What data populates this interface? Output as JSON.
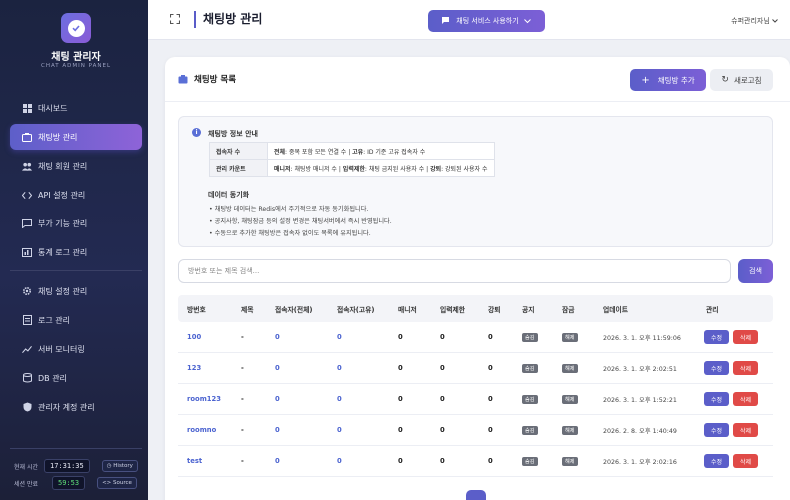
{
  "sidebar": {
    "brand_title": "채팅 관리자",
    "brand_sub": "CHAT ADMIN PANEL",
    "items": [
      {
        "label": "대시보드",
        "icon": "dashboard-icon"
      },
      {
        "label": "채팅방 관리",
        "icon": "chatroom-icon",
        "active": true
      },
      {
        "label": "채팅 회원 관리",
        "icon": "users-icon"
      },
      {
        "label": "API 설정 관리",
        "icon": "code-icon"
      },
      {
        "label": "부가 기능 관리",
        "icon": "message-icon"
      },
      {
        "label": "통계 로그 관리",
        "icon": "chart-icon"
      },
      {
        "label": "채팅 설정 관리",
        "icon": "gear-icon"
      },
      {
        "label": "로그 관리",
        "icon": "document-icon"
      },
      {
        "label": "서버 모니터링",
        "icon": "monitor-icon"
      },
      {
        "label": "DB 관리",
        "icon": "database-icon"
      },
      {
        "label": "관리자 계정 관리",
        "icon": "shield-icon"
      }
    ],
    "current_time_label": "현재 시간",
    "current_time": "17:31:35",
    "history_label": "History",
    "session_label": "세션 만료",
    "session_time": "59:53",
    "source_label": "Source"
  },
  "topbar": {
    "title": "채팅방 관리",
    "service_button": "채팅 서비스 사용하기",
    "user": "슈퍼관리자님"
  },
  "card": {
    "title": "채팅방 목록",
    "add_button": "채팅방 추가",
    "refresh_button": "새로고침"
  },
  "info": {
    "title": "채팅방 정보 안내",
    "rows": [
      {
        "key": "접속자 수",
        "value_parts": [
          {
            "b": "전체"
          },
          {
            "t": ": 중복 포함 모든 연결 수  |  "
          },
          {
            "b": "고유"
          },
          {
            "t": ": ID 기준 고유 접속자 수"
          }
        ]
      },
      {
        "key": "관리 카운트",
        "value_parts": [
          {
            "b": "매니저"
          },
          {
            "t": ": 채팅방 매니저 수  |  "
          },
          {
            "b": "입력제한"
          },
          {
            "t": ": 채팅 금지된 사용자 수  |  "
          },
          {
            "b": "강퇴"
          },
          {
            "t": ": 강퇴된 사용자 수"
          }
        ]
      }
    ],
    "sync_title": "데이터 동기화",
    "sync_items": [
      "채팅방 데이터는 Redis에서 주기적으로 자동 동기화됩니다.",
      "공지사항, 채팅잠금 등의 설정 변경은 채팅서버에서 즉시 반영됩니다.",
      "수동으로 추가한 채팅방은 접속자 없이도 목록에 유지됩니다."
    ]
  },
  "search": {
    "placeholder": "방번호 또는 제목 검색...",
    "button": "검색"
  },
  "table": {
    "headers": [
      "방번호",
      "제목",
      "접속자(전체)",
      "접속자(고유)",
      "매니저",
      "입력제한",
      "강퇴",
      "공지",
      "잠금",
      "업데이트",
      "관리"
    ],
    "rows": [
      {
        "id": "100",
        "title": "-",
        "total": "0",
        "unique": "0",
        "managers": "0",
        "restricted": "0",
        "kicked": "0",
        "notice": "숨김",
        "lock": "해제",
        "updated": "2026. 3. 1. 오후 11:59:06"
      },
      {
        "id": "123",
        "title": "-",
        "total": "0",
        "unique": "0",
        "managers": "0",
        "restricted": "0",
        "kicked": "0",
        "notice": "숨김",
        "lock": "해제",
        "updated": "2026. 3. 1. 오후 2:02:51"
      },
      {
        "id": "room123",
        "title": "-",
        "total": "0",
        "unique": "0",
        "managers": "0",
        "restricted": "0",
        "kicked": "0",
        "notice": "숨김",
        "lock": "해제",
        "updated": "2026. 3. 1. 오후 1:52:21"
      },
      {
        "id": "roomno",
        "title": "-",
        "total": "0",
        "unique": "0",
        "managers": "0",
        "restricted": "0",
        "kicked": "0",
        "notice": "숨김",
        "lock": "해제",
        "updated": "2026. 2. 8. 오후 1:40:49"
      },
      {
        "id": "test",
        "title": "-",
        "total": "0",
        "unique": "0",
        "managers": "0",
        "restricted": "0",
        "kicked": "0",
        "notice": "숨김",
        "lock": "해제",
        "updated": "2026. 3. 1. 오후 2:02:16"
      }
    ],
    "edit_label": "수정",
    "delete_label": "삭제"
  },
  "colors": {
    "accent": "#5b5ec9",
    "danger": "#e04a47",
    "sidebar": "#1b2340"
  }
}
